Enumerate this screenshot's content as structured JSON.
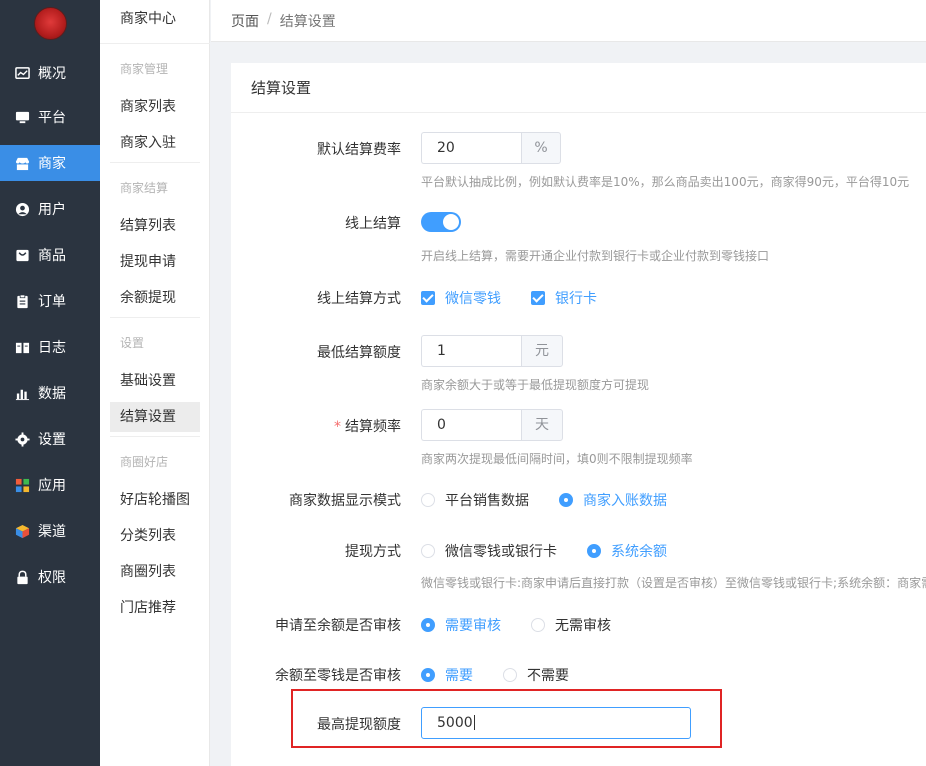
{
  "nav": {
    "items": [
      {
        "label": "概况",
        "icon": "dashboard-icon"
      },
      {
        "label": "平台",
        "icon": "monitor-icon"
      },
      {
        "label": "商家",
        "icon": "store-icon"
      },
      {
        "label": "用户",
        "icon": "user-icon"
      },
      {
        "label": "商品",
        "icon": "goods-icon"
      },
      {
        "label": "订单",
        "icon": "clipboard-icon"
      },
      {
        "label": "日志",
        "icon": "book-icon"
      },
      {
        "label": "数据",
        "icon": "bar-chart-icon"
      },
      {
        "label": "设置",
        "icon": "gear-icon"
      },
      {
        "label": "应用",
        "icon": "grid-icon"
      },
      {
        "label": "渠道",
        "icon": "cube-icon"
      },
      {
        "label": "权限",
        "icon": "lock-icon"
      }
    ],
    "active": "商家",
    "accent": "#3a8ee6"
  },
  "subnav": {
    "title": "商家中心",
    "groups": [
      {
        "label": "商家管理",
        "items": [
          "商家列表",
          "商家入驻"
        ]
      },
      {
        "label": "商家结算",
        "items": [
          "结算列表",
          "提现申请",
          "余额提现"
        ]
      },
      {
        "label": "设置",
        "items": [
          "基础设置",
          "结算设置"
        ]
      },
      {
        "label": "商圈好店",
        "items": [
          "好店轮播图",
          "分类列表",
          "商圈列表",
          "门店推荐"
        ]
      }
    ],
    "active": "结算设置"
  },
  "breadcrumb": {
    "root": "页面",
    "sep": "/",
    "current": "结算设置"
  },
  "card": {
    "title": "结算设置"
  },
  "form": {
    "rate": {
      "label": "默认结算费率",
      "value": "20",
      "unit": "%",
      "hint": "平台默认抽成比例，例如默认费率是10%，那么商品卖出100元，商家得90元，平台得10元"
    },
    "online": {
      "label": "线上结算",
      "enabled": true,
      "hint": "开启线上结算，需要开通企业付款到银行卡或企业付款到零钱接口"
    },
    "online_methods": {
      "label": "线上结算方式",
      "options": [
        "微信零钱",
        "银行卡"
      ]
    },
    "min_amount": {
      "label": "最低结算额度",
      "value": "1",
      "unit": "元",
      "hint": "商家余额大于或等于最低提现额度方可提现"
    },
    "frequency": {
      "label": "结算频率",
      "value": "0",
      "unit": "天",
      "hint": "商家两次提现最低间隔时间，填0则不限制提现频率"
    },
    "display_mode": {
      "label": "商家数据显示模式",
      "options": [
        "平台销售数据",
        "商家入账数据"
      ],
      "selected": "商家入账数据"
    },
    "withdraw_method": {
      "label": "提现方式",
      "options": [
        "微信零钱或银行卡",
        "系统余额"
      ],
      "selected": "系统余额",
      "hint": "微信零钱或银行卡:商家申请后直接打款（设置是否审核）至微信零钱或银行卡;系统余额：商家需"
    },
    "audit_balance": {
      "label": "申请至余额是否审核",
      "options": [
        "需要审核",
        "无需审核"
      ],
      "selected": "需要审核"
    },
    "audit_wallet": {
      "label": "余额至零钱是否审核",
      "options": [
        "需要",
        "不需要"
      ],
      "selected": "需要"
    },
    "max_amount": {
      "label": "最高提现额度",
      "value": "5000"
    }
  },
  "colors": {
    "primary": "#409eff",
    "highlight_box": "#e02424",
    "sidebar_bg": "#2b3440"
  }
}
